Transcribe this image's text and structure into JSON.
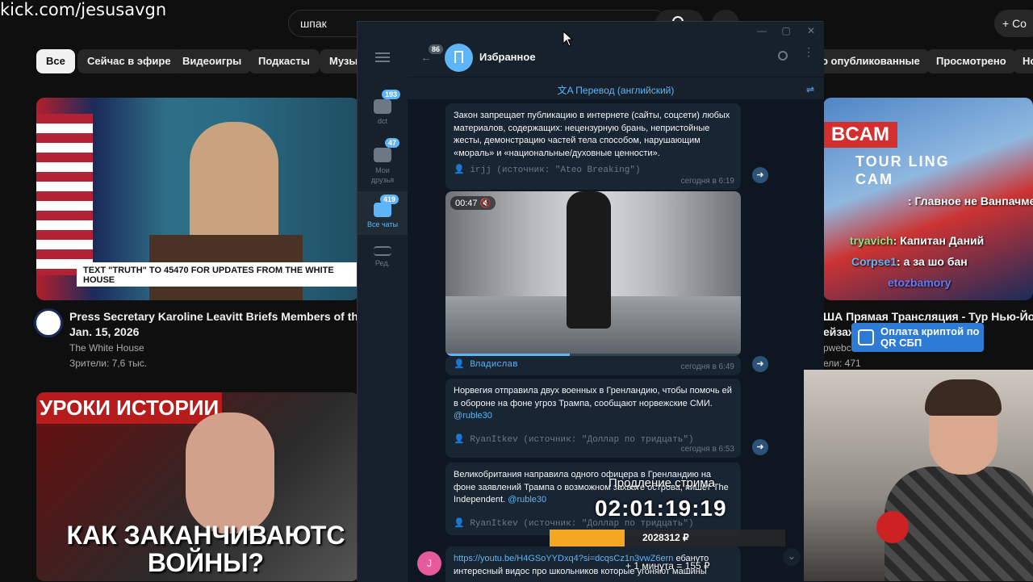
{
  "stream": {
    "channel_url": "kick.com/jesusavgn",
    "extend_label": "Продление стрима",
    "timer": "02:01:19:19",
    "goal_amount": "2028312 ₽",
    "goal_progress": 0.32,
    "minute_price": "+ 1 минута = 155 ₽"
  },
  "youtube": {
    "search_value": "шпак",
    "create_label": "+ Со",
    "chips": [
      "Все",
      "Сейчас в эфире",
      "Видеоигры",
      "Подкасты",
      "Музы",
      "о опубликованные",
      "Просмотрено",
      "Но"
    ],
    "videos": [
      {
        "title": "Press Secretary Karoline Leavitt Briefs Members of the Me",
        "title2": "Jan. 15, 2026",
        "channel": "The White House",
        "views": "Зрители: 7,6 тыс.",
        "banner": "TEXT \"TRUTH\" TO 45470 FOR UPDATES FROM THE WHITE HOUSE"
      },
      {
        "title_overlay": "УРОКИ ИСТОРИИ",
        "cta": "КАК ЗАКАНЧИВАЮТС ВОЙНЫ?"
      },
      {
        "title": "ША Прямая Трансляция - Тур Нью-Йорк",
        "title2": "ейзаж",
        "channel": "pwebcam",
        "views": "ели: 471",
        "cam_label": "BCAM",
        "tour_label": "TOUR LING CAM"
      }
    ]
  },
  "telegram": {
    "chat_title": "Избранное",
    "back_badge": "86",
    "translate_label": "Перевод (английский)",
    "folders": [
      {
        "label": "dct",
        "badge": "193"
      },
      {
        "label": "Мои друзья",
        "badge": "47"
      },
      {
        "label": "Все чаты",
        "badge": "419"
      },
      {
        "label": "Ред.",
        "badge": ""
      }
    ],
    "messages": [
      {
        "text": "Закон запрещает публикацию в интернете (сайты, соцсети) любых материалов, содержащих: нецензурную брань, непристойные жесты, демонстрацию частей тела способом, нарушающим «мораль» и «национальные/духовные ценности».",
        "signature": "irjj (источник: \"Ateo Breaking\")",
        "time": "сегодня в 6:19"
      },
      {
        "duration": "00:47",
        "video_progress": 0.42,
        "signature": "Владислав",
        "time": "сегодня в 6:49"
      },
      {
        "text": "Норвегия отправила двух военных в Гренландию, чтобы помочь ей в обороне на фоне угроз Трампа, сообщают норвежские СМИ.",
        "link": "@ruble30",
        "signature": "RyanItkev (источник: \"Доллар по тридцать\")",
        "time": "сегодня в 6:53"
      },
      {
        "text": "Великобритания направила одного офицера в Гренландию на фоне заявлений Трампа о возможном захвате острова, пишет The Independent.",
        "link": "@ruble30",
        "signature": "RyanItkev (источник: \"Доллар по тридцать\")",
        "time": ""
      },
      {
        "avatar_letter": "J",
        "link": "https://youtu.be/H4GSoYYDxq4?si=dcqsCz1n3vwZ6ern",
        "text": " ебануто интересный видос про школьников которые угоняют машины"
      }
    ]
  },
  "overlay_chat": [
    {
      "user": "",
      "text": ": Главное не Ванпачмена"
    },
    {
      "user": "tryavich",
      "text": ": Капитан Даний"
    },
    {
      "user": "Corpse1",
      "text": ": а за шо бан"
    },
    {
      "user": "etozbamory",
      "text": ""
    }
  ],
  "pay_label": "Оплата криптой по QR СБП"
}
